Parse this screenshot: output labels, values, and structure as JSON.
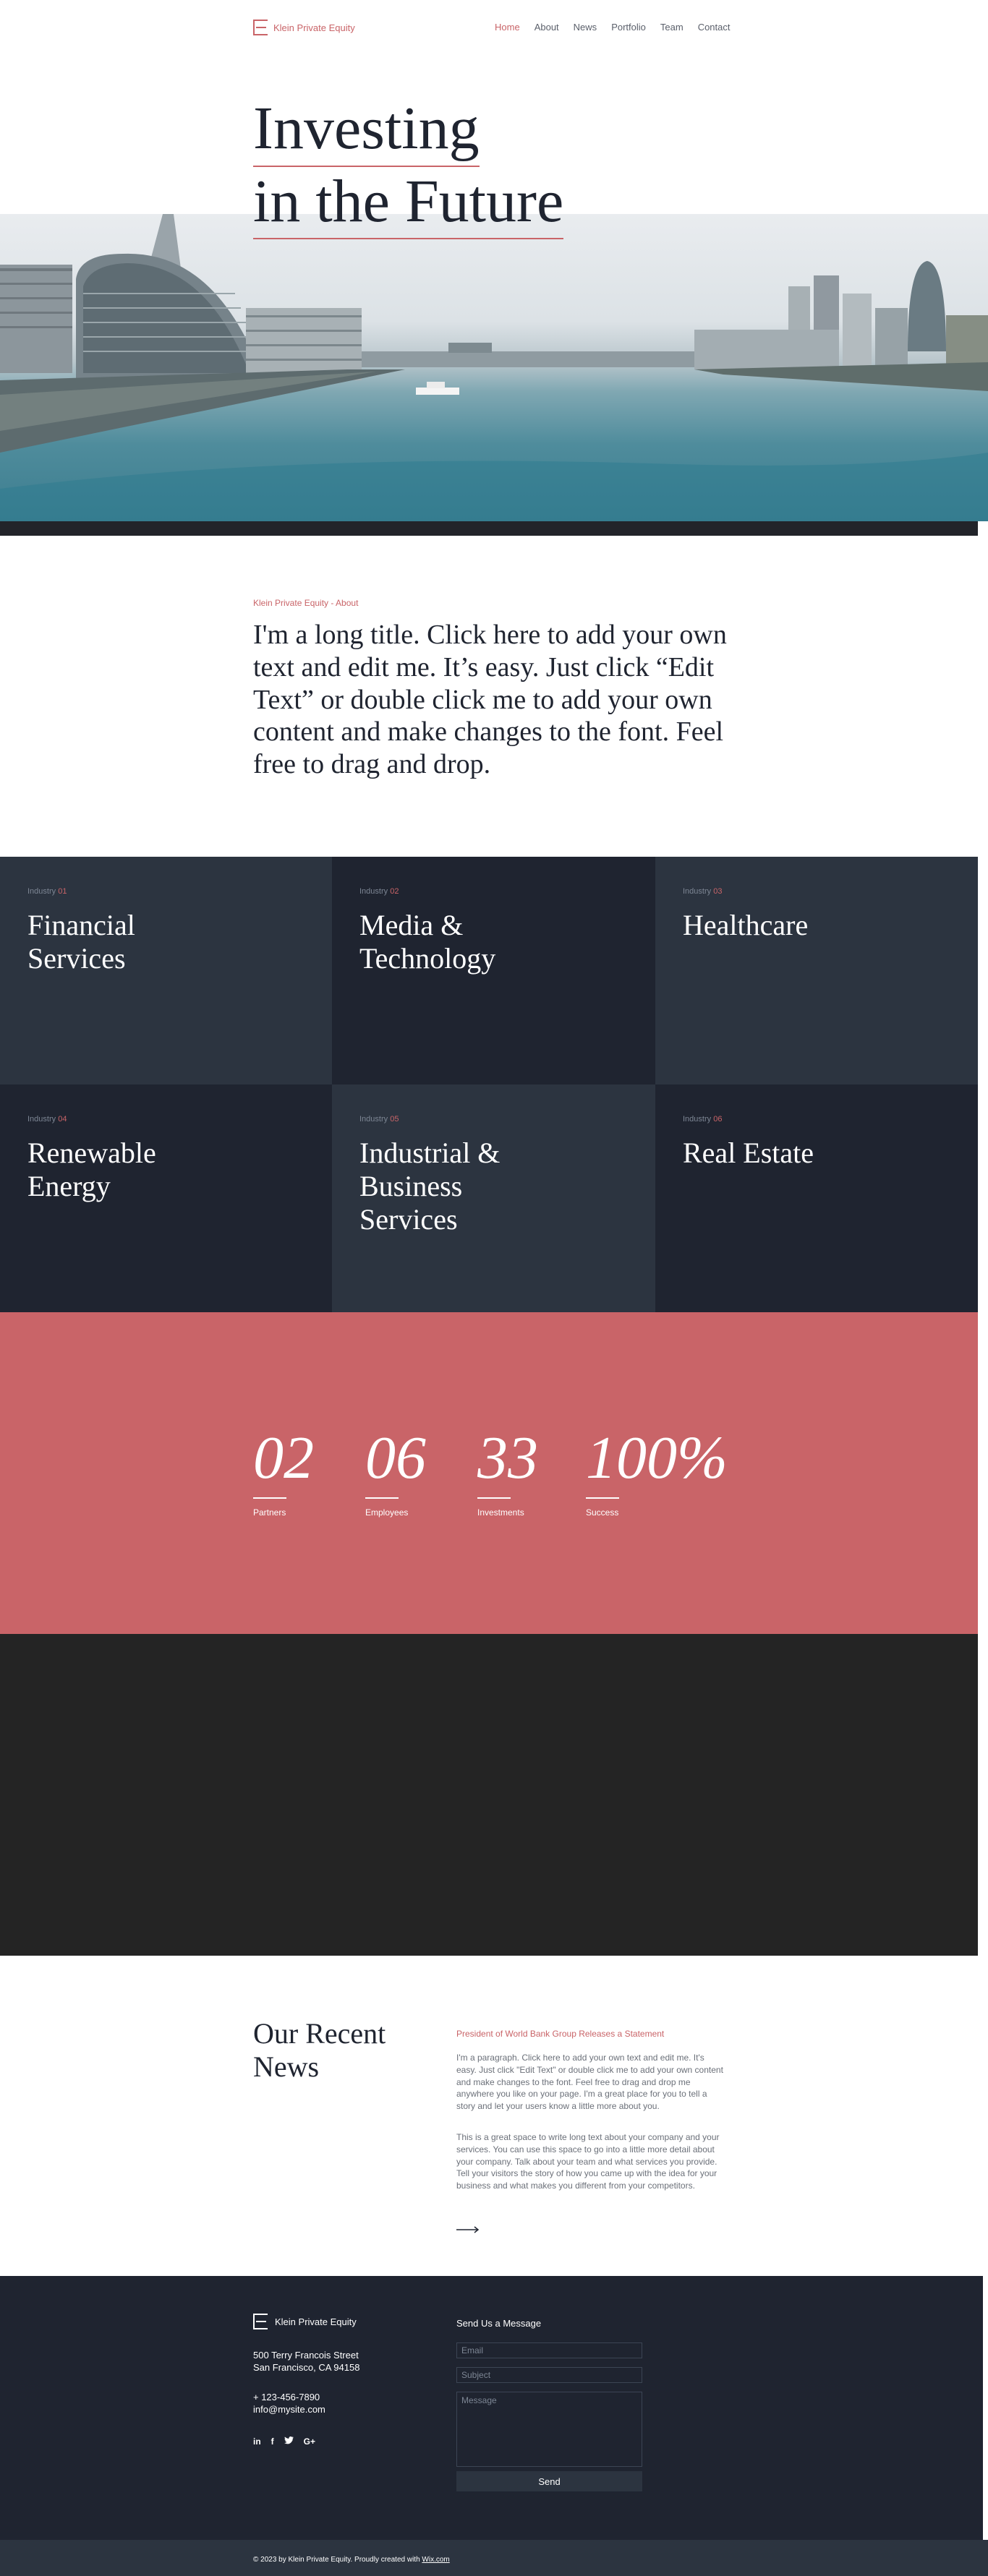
{
  "header": {
    "logo_text": "Klein Private Equity",
    "nav": [
      "Home",
      "About",
      "News",
      "Portfolio",
      "Team",
      "Contact"
    ],
    "active_nav": "Home"
  },
  "hero": {
    "title_line1": "Investing",
    "title_line2": "in the Future"
  },
  "about": {
    "label": "Klein Private Equity - About",
    "title": "I'm a long title. Click here to add your own text and edit me. It’s easy. Just click “Edit Text” or double click me to add your own content and make changes to the font. Feel free to drag and drop."
  },
  "industries": [
    {
      "tag": "Industry",
      "num": "01",
      "name": "Financial Services"
    },
    {
      "tag": "Industry",
      "num": "02",
      "name": "Media & Technology"
    },
    {
      "tag": "Industry",
      "num": "03",
      "name": "Healthcare"
    },
    {
      "tag": "Industry",
      "num": "04",
      "name": "Renewable Energy"
    },
    {
      "tag": "Industry",
      "num": "05",
      "name": "Industrial & Business Services"
    },
    {
      "tag": "Industry",
      "num": "06",
      "name": "Real Estate"
    }
  ],
  "stats": [
    {
      "value": "02",
      "label": "Partners"
    },
    {
      "value": "06",
      "label": "Employees"
    },
    {
      "value": "33",
      "label": "Investments"
    },
    {
      "value": "100%",
      "label": "Success"
    }
  ],
  "news": {
    "section_title_line1": "Our Recent",
    "section_title_line2": "News",
    "headline": "President of World Bank Group Releases a Statement",
    "paragraph1": "I'm a paragraph. Click here to add your own text and edit me. It's easy. Just click \"Edit Text\" or double click me to add your own content and make changes to the font. Feel free to drag and drop me anywhere you like on your page. I'm a great place for you to tell a story and let your users know a little more about you.",
    "paragraph2": "This is a great space to write long text about your company and your services. You can use this space to go into a little more detail about your company. Talk about your team and what services you provide. Tell your visitors the story of how you came up with the idea for your business and what makes you different from your competitors."
  },
  "footer": {
    "logo_text": "Klein Private Equity",
    "address_line1": "500 Terry Francois Street",
    "address_line2": "San Francisco, CA 94158",
    "phone": "+ 123-456-7890",
    "email": "info@mysite.com",
    "social": [
      "in",
      "f",
      "t",
      "G+"
    ],
    "form_title": "Send Us a Message",
    "email_placeholder": "Email",
    "subject_placeholder": "Subject",
    "message_placeholder": "Message",
    "send_label": "Send",
    "copyright": "© 2023 by Klein Private Equity. Proudly created with",
    "copyright_link": "Wix.com"
  },
  "colors": {
    "accent": "#c96468",
    "navy": "#1f2430",
    "slate": "#2c3440"
  }
}
